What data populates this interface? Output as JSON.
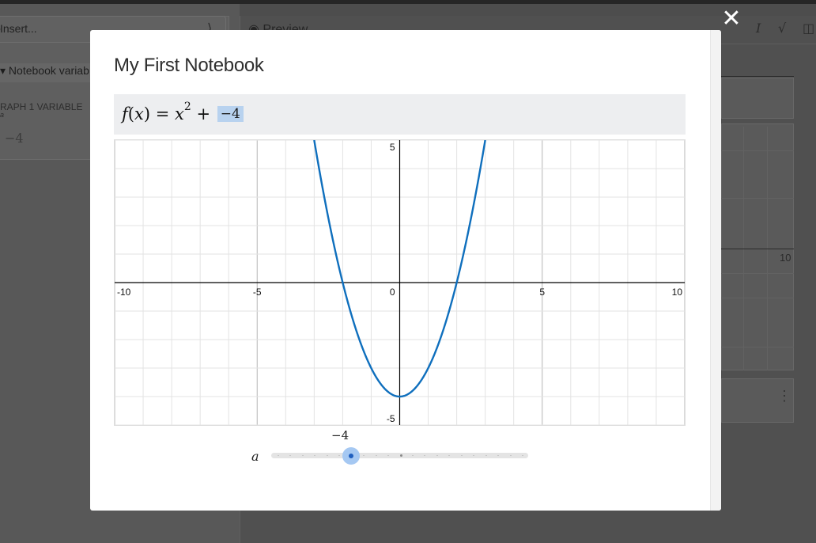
{
  "background": {
    "insert_placeholder": "Insert...",
    "notebook_variables": "Notebook variab",
    "graph_variables_label": "RAPH 1 VARIABLE",
    "graph_variable_name": "a",
    "graph_variable_value": "−4",
    "preview_label": "Preview",
    "axis_label_10": "10"
  },
  "modal": {
    "close_label": "✕",
    "title": "My First Notebook",
    "expression": {
      "lhs_fn": "f",
      "lhs_var": "x",
      "equals": "=",
      "base": "x",
      "exponent": "2",
      "plus": "+",
      "param_value": "−4"
    },
    "slider": {
      "name": "a",
      "value_label": "−4",
      "value": -4,
      "min": -10,
      "max": 10
    }
  },
  "chart_data": {
    "type": "line",
    "function": "x^2 + a",
    "param_a": -4,
    "series": [
      {
        "x": [
          -3,
          -2.5,
          -2,
          -1.5,
          -1,
          -0.5,
          0,
          0.5,
          1,
          1.5,
          2,
          2.5,
          3
        ],
        "y": [
          5,
          2.25,
          0,
          -1.75,
          -3,
          -3.75,
          -4,
          -3.75,
          -3,
          -1.75,
          0,
          2.25,
          5
        ]
      }
    ],
    "xlim": [
      -10,
      10
    ],
    "ylim": [
      -5,
      5
    ],
    "x_ticks": [
      "-10",
      "-5",
      "0",
      "5",
      "10"
    ],
    "y_ticks": [
      "5",
      "-5"
    ],
    "grid": true,
    "colors": {
      "curve": "#0f6fbd",
      "grid": "#e3e3e3",
      "grid_major": "#b5b5b5",
      "axis": "#000000"
    }
  },
  "colors": {
    "overlay": "#4d4d4d",
    "modal_bg": "#ffffff",
    "expr_bg": "#edeef0",
    "value_chip": "#b8d2ef",
    "slider_thumb": "#a5c8f2",
    "slider_dot": "#1f5fbf"
  }
}
